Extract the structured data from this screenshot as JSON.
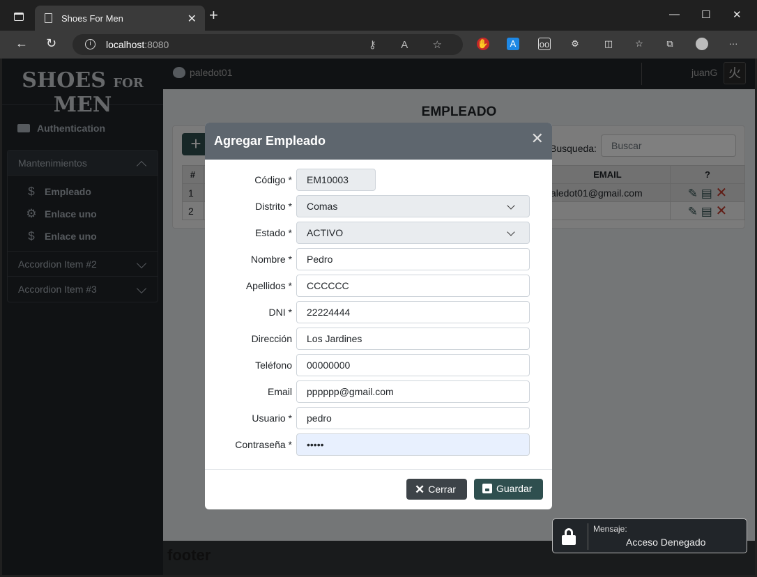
{
  "browser": {
    "tab_title": "Shoes For Men",
    "url_host": "localhost",
    "url_port": ":8080"
  },
  "sidebar": {
    "brand_main": "SHOES",
    "brand_for": "FOR",
    "brand_end": "MEN",
    "auth_label": "Authentication",
    "accordion": [
      {
        "label": "Mantenimientos",
        "open": true
      },
      {
        "label": "Accordion Item #2",
        "open": false
      },
      {
        "label": "Accordion Item #3",
        "open": false
      }
    ],
    "sub_items": [
      {
        "label": "Empleado",
        "icon": "dollar-icon"
      },
      {
        "label": "Enlace uno",
        "icon": "gear-icon"
      },
      {
        "label": "Enlace uno",
        "icon": "dollar-icon"
      }
    ]
  },
  "topbar": {
    "github_user": "paledot01",
    "user_name": "juanG"
  },
  "page": {
    "title": "EMPLEADO",
    "search_label": "Busqueda:",
    "search_placeholder": "Buscar",
    "table": {
      "headers": [
        "#",
        "EMAIL",
        "?"
      ],
      "rows": [
        {
          "num": "1",
          "email": "aledot01@gmail.com"
        },
        {
          "num": "2",
          "email": ""
        }
      ]
    },
    "footer": "footer"
  },
  "modal": {
    "title": "Agregar Empleado",
    "fields": {
      "codigo": {
        "label": "Código *",
        "value": "EM10003"
      },
      "distrito": {
        "label": "Distrito *",
        "value": "Comas"
      },
      "estado": {
        "label": "Estado *",
        "value": "ACTIVO"
      },
      "nombre": {
        "label": "Nombre *",
        "value": "Pedro"
      },
      "apellidos": {
        "label": "Apellidos *",
        "value": "CCCCCC"
      },
      "dni": {
        "label": "DNI *",
        "value": "22224444"
      },
      "direccion": {
        "label": "Dirección",
        "value": "Los Jardines"
      },
      "telefono": {
        "label": "Teléfono",
        "value": "00000000"
      },
      "email": {
        "label": "Email",
        "value": "pppppp@gmail.com"
      },
      "usuario": {
        "label": "Usuario *",
        "value": "pedro"
      },
      "contrasena": {
        "label": "Contraseña *",
        "value": "•••••"
      }
    },
    "close_label": "Cerrar",
    "save_label": "Guardar"
  },
  "toast": {
    "title": "Mensaje:",
    "message": "Acceso Denegado"
  },
  "colors": {
    "primary_dark": "#2f4f4f",
    "sidebar_bg": "#212529",
    "modal_header": "#5e666e",
    "danger": "#c0392b"
  }
}
